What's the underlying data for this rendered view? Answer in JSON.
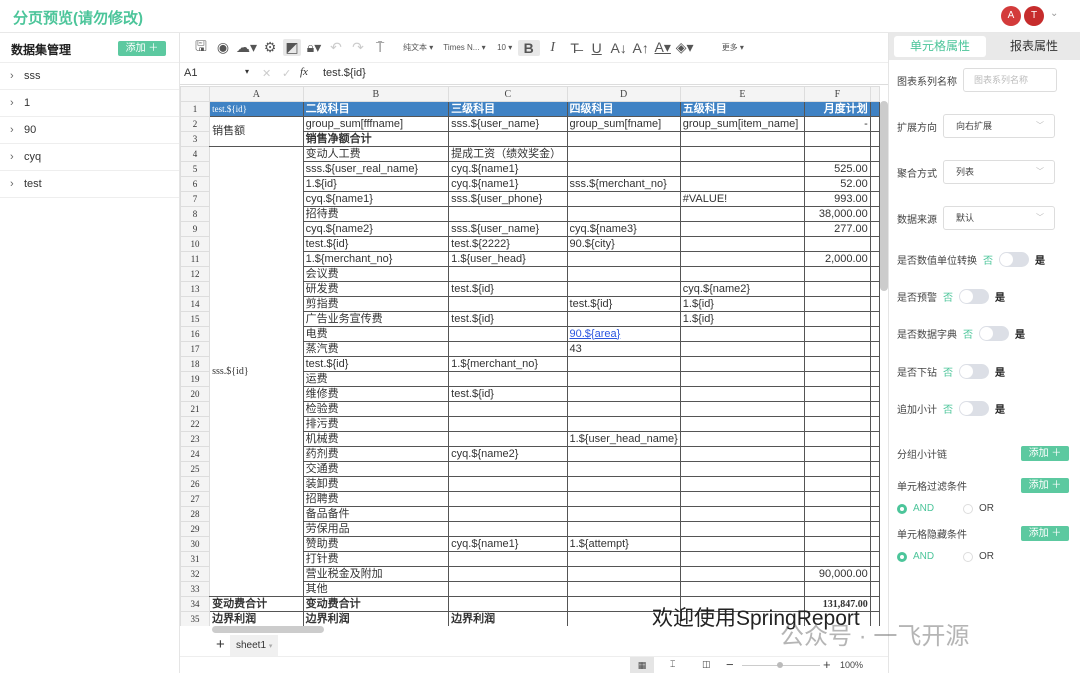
{
  "header": {
    "title": "分页预览(请勿修改)",
    "avatars": [
      "A",
      "T"
    ],
    "accent": "#4cc59a"
  },
  "sidebar": {
    "title": "数据集管理",
    "add_label": "添加 ＋",
    "items": [
      {
        "label": "sss"
      },
      {
        "label": "1"
      },
      {
        "label": "90"
      },
      {
        "label": "cyq"
      },
      {
        "label": "test"
      }
    ]
  },
  "toolbar": {
    "items": [
      "save-icon",
      "preview-icon",
      "upload-icon",
      "settings-icon",
      "clear-format-icon",
      "lock-icon",
      "undo-icon",
      "redo-icon",
      "format-painter-icon"
    ],
    "format": "纯文本",
    "font": "Times N...",
    "size": "10",
    "more": "更多"
  },
  "formula": {
    "cell": "A1",
    "fx": "fx",
    "value": "test.${id}"
  },
  "grid": {
    "columns": [
      "A",
      "B",
      "C",
      "D",
      "E",
      "F"
    ],
    "header_color": "#3f82c4",
    "a_blocks": [
      {
        "rows": [
          1,
          1
        ],
        "text": "test.${id}"
      },
      {
        "rows": [
          2,
          3
        ],
        "text": "销售额"
      },
      {
        "rows": [
          4,
          33
        ],
        "text": "sss.${id}"
      },
      {
        "rows": [
          34,
          34
        ],
        "text": "变动费合计"
      },
      {
        "rows": [
          35,
          35
        ],
        "text": "边界利润"
      }
    ],
    "rows": [
      [
        "二级科目",
        "三级科目",
        "四级科目",
        "五级科目",
        "月度计划"
      ],
      [
        "group_sum[fffname]",
        "sss.${user_name}",
        "group_sum[fname]",
        "group_sum[item_name]",
        "-"
      ],
      [
        "销售净额合计",
        "",
        "",
        "",
        ""
      ],
      [
        "变动人工费",
        "提成工资（绩效奖金）",
        "",
        "",
        ""
      ],
      [
        "sss.${user_real_name}",
        "cyq.${name1}",
        "",
        "",
        "525.00"
      ],
      [
        "1.${id}",
        "cyq.${name1}",
        "sss.${merchant_no}",
        "",
        "52.00"
      ],
      [
        "cyq.${name1}",
        "sss.${user_phone}",
        "",
        "#VALUE!",
        "993.00"
      ],
      [
        "招待费",
        "",
        "",
        "",
        "38,000.00"
      ],
      [
        "cyq.${name2}",
        "sss.${user_name}",
        "cyq.${name3}",
        "",
        "277.00"
      ],
      [
        "test.${id}",
        "test.${2222}",
        "90.${city}",
        "",
        ""
      ],
      [
        "1.${merchant_no}",
        "1.${user_head}",
        "",
        "",
        "2,000.00"
      ],
      [
        "会议费",
        "",
        "",
        "",
        ""
      ],
      [
        "研发费",
        "test.${id}",
        "",
        "cyq.${name2}",
        ""
      ],
      [
        "剪指费",
        "",
        "test.${id}",
        "1.${id}",
        ""
      ],
      [
        "广告业务宣传费",
        "test.${id}",
        "",
        "1.${id}",
        ""
      ],
      [
        "电费",
        "",
        "90.${area}",
        "",
        ""
      ],
      [
        "蒸汽费",
        "",
        "43",
        "",
        ""
      ],
      [
        "test.${id}",
        "1.${merchant_no}",
        "",
        "",
        ""
      ],
      [
        "运费",
        "",
        "",
        "",
        ""
      ],
      [
        "维修费",
        "test.${id}",
        "",
        "",
        ""
      ],
      [
        "检验费",
        "",
        "",
        "",
        ""
      ],
      [
        "排污费",
        "",
        "",
        "",
        ""
      ],
      [
        "机械费",
        "",
        "1.${user_head_name}",
        "",
        ""
      ],
      [
        "药剂费",
        "cyq.${name2}",
        "",
        "",
        ""
      ],
      [
        "交通费",
        "",
        "",
        "",
        ""
      ],
      [
        "装卸费",
        "",
        "",
        "",
        ""
      ],
      [
        "招聘费",
        "",
        "",
        "",
        ""
      ],
      [
        "备品备件",
        "",
        "",
        "",
        ""
      ],
      [
        "劳保用品",
        "",
        "",
        "",
        ""
      ],
      [
        "赞助费",
        "cyq.${name1}",
        "1.${attempt}",
        "",
        ""
      ],
      [
        "打针费",
        "",
        "",
        "",
        ""
      ],
      [
        "营业税金及附加",
        "",
        "",
        "",
        "90,000.00"
      ],
      [
        "其他",
        "",
        "",
        "",
        ""
      ],
      [
        "变动费合计",
        "",
        "",
        "",
        "131,847.00"
      ],
      [
        "边界利润",
        "边界利润",
        "",
        "",
        ""
      ]
    ]
  },
  "sheet_tabs": {
    "add": "+",
    "tabs": [
      "sheet1"
    ]
  },
  "status": {
    "zoom": "100%"
  },
  "right_panel": {
    "tabs": [
      "单元格属性",
      "报表属性"
    ],
    "series_name_label": "图表系列名称",
    "series_name_placeholder": "图表系列名称",
    "expand_label": "扩展方向",
    "expand_value": "向右扩展",
    "aggregate_label": "聚合方式",
    "aggregate_value": "列表",
    "source_label": "数据来源",
    "source_value": "默认",
    "switches": [
      {
        "label": "是否数值单位转换",
        "off": "否",
        "on": "是",
        "value": false
      },
      {
        "label": "是否预警",
        "off": "否",
        "on": "是",
        "value": false
      },
      {
        "label": "是否数据字典",
        "off": "否",
        "on": "是",
        "value": false
      },
      {
        "label": "是否下钻",
        "off": "否",
        "on": "是",
        "value": false
      },
      {
        "label": "追加小计",
        "off": "否",
        "on": "是",
        "value": false
      }
    ],
    "group_subtotal_label": "分组小计链",
    "filter_label": "单元格过滤条件",
    "hide_label": "单元格隐藏条件",
    "add_label": "添加 ＋",
    "and_label": "AND",
    "or_label": "OR",
    "filter_logic": "AND",
    "hide_logic": "AND"
  },
  "watermark": {
    "line1": "欢迎使用SpringReport",
    "line2": "公众号 · 一飞开源"
  }
}
